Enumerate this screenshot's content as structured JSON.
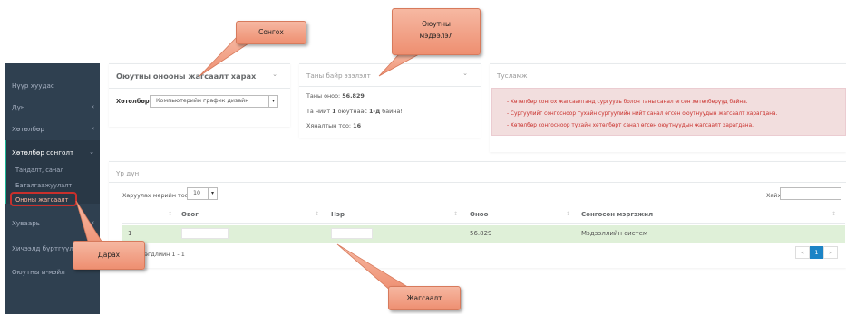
{
  "sidebar": {
    "items": [
      {
        "label": "Нүүр хуудас",
        "arrow": ""
      },
      {
        "label": "Дүн",
        "arrow": "‹"
      },
      {
        "label": "Хөтөлбөр",
        "arrow": "‹"
      },
      {
        "label": "Хөтөлбөр сонголт",
        "arrow": "⌄"
      },
      {
        "label": "Хуваарь",
        "arrow": "‹"
      },
      {
        "label": "Хичээлд бүртгүүлэх",
        "arrow": "‹"
      },
      {
        "label": "Оюутны и-мэйл",
        "arrow": ""
      }
    ],
    "subitems": [
      "Тандалт, санал",
      "Баталгаажуулалт",
      "Ононы жагсаалт"
    ]
  },
  "choose_panel": {
    "title": "Оюутны онооны жагсаалт харах",
    "program_label": "Хөтөлбөр:",
    "program_value": "Компьютерийн график дизайн"
  },
  "score_panel": {
    "title": "Таны байр эзэлэлт",
    "score_prefix": "Таны оноо:",
    "score_value": "56.829",
    "rank_prefix": "Та нийт",
    "rank_count": "1",
    "rank_mid": "оюутнаас",
    "rank_place": "1-д",
    "rank_suffix": "байна!",
    "cap_label": "Хяналтын тоо:",
    "cap_value": "16"
  },
  "help_panel": {
    "title": "Тусламж",
    "lines": [
      "- Хөтөлбөр сонгох жагсаалтанд сургууль болон таны санал өгсөн хөтөлбөрүүд байна.",
      "- Сургуулийг сонгосноор тухайн сургуулийн нийт санал өгсөн оюутнуудын жагсаалт харагдана.",
      "- Хөтөлбөр сонгосноор тухайн хөтөлбөрт санал өгсөн оюутнуудын жагсаалт харагдана."
    ]
  },
  "results_panel": {
    "title": "Үр дүн",
    "page_size_label": "Харуулах мөрийн тоо:",
    "page_size_value": "10",
    "search_label": "Хайх:",
    "search_value": "",
    "columns": [
      "Овог",
      "Нэр",
      "Оноо",
      "Сонгосон мэргэжил"
    ],
    "rows": [
      {
        "index": "1",
        "last_name": "",
        "first_name": "",
        "score": "56.829",
        "major": "Мэдээллийн систем"
      }
    ],
    "info": "...гэгдлийн 1 - 1",
    "pager": {
      "prev": "«",
      "current": "1",
      "next": "»"
    }
  },
  "callouts": {
    "choose": "Сонгох",
    "info": "Оюутны\nмэдээлэл",
    "click": "Дарах",
    "list": "Жагсаалт"
  },
  "colors": {
    "sidebar_bg": "#2f4050",
    "accent": "#1ab394",
    "row_highlight": "#dff0d8",
    "alert_text": "#c9302c",
    "callout": "#ee8f71",
    "pager_active": "#1c84c6"
  }
}
